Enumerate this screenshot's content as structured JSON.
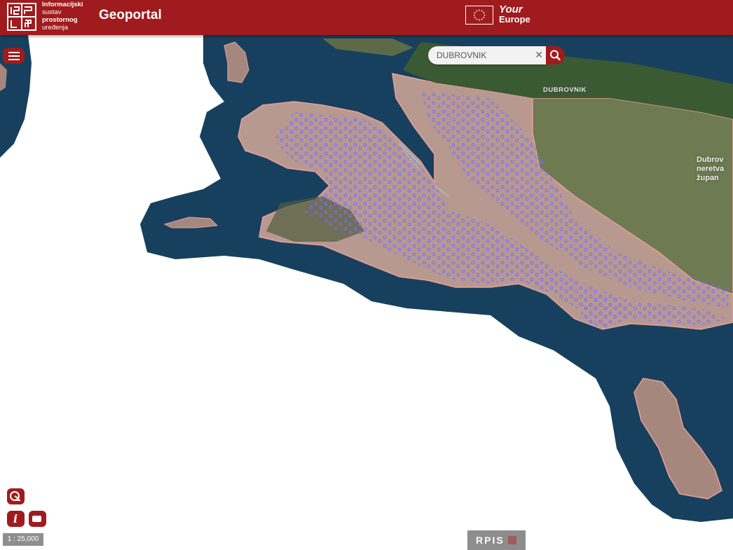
{
  "header": {
    "logo_icon": "ispu-logo",
    "logo_lines": {
      "l1": "Informacijski",
      "l2": "sustav",
      "l3": "prostornog",
      "l4": "uređenja"
    },
    "app_title": "Geoportal",
    "eu_flag_icon": "eu-flag",
    "your_europe": {
      "l1": "Your",
      "l2": "Europe"
    }
  },
  "search": {
    "value": "DUBROVNIK",
    "clear_icon": "close-icon",
    "button_icon": "search-icon"
  },
  "menu": {
    "icon": "hamburger-menu-icon"
  },
  "map": {
    "place_label": "DUBROVNIK",
    "county_label": {
      "l1": "Dubrov",
      "l2": "neretva",
      "l3": "župan"
    },
    "colors": {
      "sea": "#17405e",
      "land": "#b89990",
      "forest": "#3a5a33",
      "boundary": "#e8a09a",
      "points": "#5a4bff"
    }
  },
  "tools": {
    "measure_icon": "measure-icon",
    "info_icon": "info-icon",
    "video_icon": "video-camera-icon"
  },
  "scale": "1 : 25,000",
  "footer_logo": "RPIS"
}
